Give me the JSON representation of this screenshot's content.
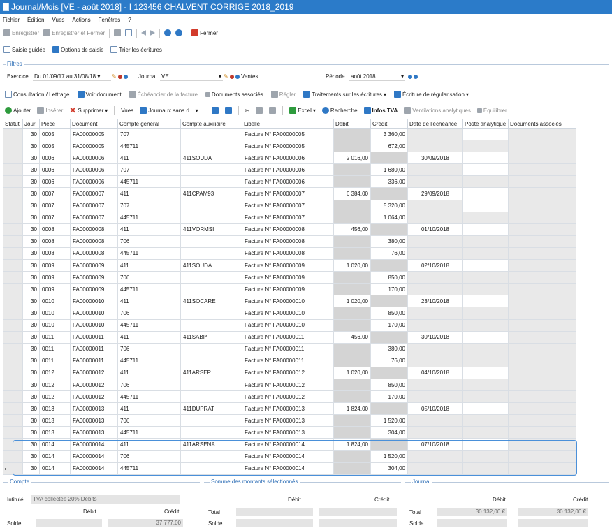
{
  "window": {
    "title": "Journal/Mois [VE - août 2018] - I 123456 CHALVENT CORRIGE 2018_2019"
  },
  "menu": [
    "Fichier",
    "Édition",
    "Vues",
    "Actions",
    "Fenêtres",
    "?"
  ],
  "toolbar1": {
    "save": "Enregistrer",
    "save_close": "Enregistrer et Fermer",
    "close": "Fermer"
  },
  "toolbar2": {
    "guided": "Saisie guidée",
    "options": "Options de saisie",
    "sort": "Trier les écritures"
  },
  "filters": {
    "legend": "Filtres",
    "exercice_label": "Exercice",
    "exercice_value": "Du 01/09/17 au 31/08/18",
    "journal_label": "Journal",
    "journal_value": "VE",
    "journal_name": "Ventes",
    "periode_label": "Période",
    "periode_value": "août 2018"
  },
  "toolbar3": {
    "consultation": "Consultation / Lettrage",
    "voir_doc": "Voir document",
    "echeancier": "Échéancier de la facture",
    "docs_assoc": "Documents associés",
    "regler": "Régler",
    "traitements": "Traitements sur les écritures",
    "regularisation": "Écriture de régularisation"
  },
  "toolbar4": {
    "ajouter": "Ajouter",
    "inserer": "Insérer",
    "supprimer": "Supprimer",
    "vues": "Vues",
    "journaux": "Journaux sans d...",
    "excel": "Excel",
    "recherche": "Recherche",
    "infos_tva": "Infos TVA",
    "ventilations": "Ventilations analytiques",
    "equilibrer": "Équilibrer"
  },
  "grid": {
    "columns": [
      "Statut",
      "Jour",
      "Pièce",
      "Document",
      "Compte général",
      "Compte auxiliaire",
      "Libellé",
      "Débit",
      "Crédit",
      "Date de l'échéance",
      "Poste analytique",
      "Documents associés"
    ],
    "rows": [
      {
        "jour": "30",
        "piece": "0005",
        "doc": "FA00000005",
        "cg": "707",
        "ca": "",
        "lib": "Facture N° FA00000005",
        "debit": "",
        "credit": "3 360,00",
        "ech": ""
      },
      {
        "jour": "30",
        "piece": "0005",
        "doc": "FA00000005",
        "cg": "445711",
        "ca": "",
        "lib": "Facture N° FA00000005",
        "debit": "",
        "credit": "672,00",
        "ech": ""
      },
      {
        "jour": "30",
        "piece": "0006",
        "doc": "FA00000006",
        "cg": "411",
        "ca": "411SOUDA",
        "lib": "Facture N° FA00000006",
        "debit": "2 016,00",
        "credit": "",
        "ech": "30/09/2018"
      },
      {
        "jour": "30",
        "piece": "0006",
        "doc": "FA00000006",
        "cg": "707",
        "ca": "",
        "lib": "Facture N° FA00000006",
        "debit": "",
        "credit": "1 680,00",
        "ech": ""
      },
      {
        "jour": "30",
        "piece": "0006",
        "doc": "FA00000006",
        "cg": "445711",
        "ca": "",
        "lib": "Facture N° FA00000006",
        "debit": "",
        "credit": "336,00",
        "ech": ""
      },
      {
        "jour": "30",
        "piece": "0007",
        "doc": "FA00000007",
        "cg": "411",
        "ca": "411CPAM93",
        "lib": "Facture N° FA00000007",
        "debit": "6 384,00",
        "credit": "",
        "ech": "29/09/2018"
      },
      {
        "jour": "30",
        "piece": "0007",
        "doc": "FA00000007",
        "cg": "707",
        "ca": "",
        "lib": "Facture N° FA00000007",
        "debit": "",
        "credit": "5 320,00",
        "ech": ""
      },
      {
        "jour": "30",
        "piece": "0007",
        "doc": "FA00000007",
        "cg": "445711",
        "ca": "",
        "lib": "Facture N° FA00000007",
        "debit": "",
        "credit": "1 064,00",
        "ech": ""
      },
      {
        "jour": "30",
        "piece": "0008",
        "doc": "FA00000008",
        "cg": "411",
        "ca": "411VORMSI",
        "lib": "Facture N° FA00000008",
        "debit": "456,00",
        "credit": "",
        "ech": "01/10/2018"
      },
      {
        "jour": "30",
        "piece": "0008",
        "doc": "FA00000008",
        "cg": "706",
        "ca": "",
        "lib": "Facture N° FA00000008",
        "debit": "",
        "credit": "380,00",
        "ech": ""
      },
      {
        "jour": "30",
        "piece": "0008",
        "doc": "FA00000008",
        "cg": "445711",
        "ca": "",
        "lib": "Facture N° FA00000008",
        "debit": "",
        "credit": "76,00",
        "ech": ""
      },
      {
        "jour": "30",
        "piece": "0009",
        "doc": "FA00000009",
        "cg": "411",
        "ca": "411SOUDA",
        "lib": "Facture N° FA00000009",
        "debit": "1 020,00",
        "credit": "",
        "ech": "02/10/2018"
      },
      {
        "jour": "30",
        "piece": "0009",
        "doc": "FA00000009",
        "cg": "706",
        "ca": "",
        "lib": "Facture N° FA00000009",
        "debit": "",
        "credit": "850,00",
        "ech": ""
      },
      {
        "jour": "30",
        "piece": "0009",
        "doc": "FA00000009",
        "cg": "445711",
        "ca": "",
        "lib": "Facture N° FA00000009",
        "debit": "",
        "credit": "170,00",
        "ech": ""
      },
      {
        "jour": "30",
        "piece": "0010",
        "doc": "FA00000010",
        "cg": "411",
        "ca": "411SOCARE",
        "lib": "Facture N° FA00000010",
        "debit": "1 020,00",
        "credit": "",
        "ech": "23/10/2018"
      },
      {
        "jour": "30",
        "piece": "0010",
        "doc": "FA00000010",
        "cg": "706",
        "ca": "",
        "lib": "Facture N° FA00000010",
        "debit": "",
        "credit": "850,00",
        "ech": ""
      },
      {
        "jour": "30",
        "piece": "0010",
        "doc": "FA00000010",
        "cg": "445711",
        "ca": "",
        "lib": "Facture N° FA00000010",
        "debit": "",
        "credit": "170,00",
        "ech": ""
      },
      {
        "jour": "30",
        "piece": "0011",
        "doc": "FA00000011",
        "cg": "411",
        "ca": "411SABP",
        "lib": "Facture N° FA00000011",
        "debit": "456,00",
        "credit": "",
        "ech": "30/10/2018"
      },
      {
        "jour": "30",
        "piece": "0011",
        "doc": "FA00000011",
        "cg": "706",
        "ca": "",
        "lib": "Facture N° FA00000011",
        "debit": "",
        "credit": "380,00",
        "ech": ""
      },
      {
        "jour": "30",
        "piece": "0011",
        "doc": "FA00000011",
        "cg": "445711",
        "ca": "",
        "lib": "Facture N° FA00000011",
        "debit": "",
        "credit": "76,00",
        "ech": ""
      },
      {
        "jour": "30",
        "piece": "0012",
        "doc": "FA00000012",
        "cg": "411",
        "ca": "411ARSEP",
        "lib": "Facture N° FA00000012",
        "debit": "1 020,00",
        "credit": "",
        "ech": "04/10/2018"
      },
      {
        "jour": "30",
        "piece": "0012",
        "doc": "FA00000012",
        "cg": "706",
        "ca": "",
        "lib": "Facture N° FA00000012",
        "debit": "",
        "credit": "850,00",
        "ech": ""
      },
      {
        "jour": "30",
        "piece": "0012",
        "doc": "FA00000012",
        "cg": "445711",
        "ca": "",
        "lib": "Facture N° FA00000012",
        "debit": "",
        "credit": "170,00",
        "ech": ""
      },
      {
        "jour": "30",
        "piece": "0013",
        "doc": "FA00000013",
        "cg": "411",
        "ca": "411DUPRAT",
        "lib": "Facture N° FA00000013",
        "debit": "1 824,00",
        "credit": "",
        "ech": "05/10/2018"
      },
      {
        "jour": "30",
        "piece": "0013",
        "doc": "FA00000013",
        "cg": "706",
        "ca": "",
        "lib": "Facture N° FA00000013",
        "debit": "",
        "credit": "1 520,00",
        "ech": ""
      },
      {
        "jour": "30",
        "piece": "0013",
        "doc": "FA00000013",
        "cg": "445711",
        "ca": "",
        "lib": "Facture N° FA00000013",
        "debit": "",
        "credit": "304,00",
        "ech": ""
      },
      {
        "jour": "30",
        "piece": "0014",
        "doc": "FA00000014",
        "cg": "411",
        "ca": "411ARSENA",
        "lib": "Facture N° FA00000014",
        "debit": "1 824,00",
        "credit": "",
        "ech": "07/10/2018"
      },
      {
        "jour": "30",
        "piece": "0014",
        "doc": "FA00000014",
        "cg": "706",
        "ca": "",
        "lib": "Facture N° FA00000014",
        "debit": "",
        "credit": "1 520,00",
        "ech": ""
      },
      {
        "jour": "30",
        "piece": "0014",
        "doc": "FA00000014",
        "cg": "445711",
        "ca": "",
        "lib": "Facture N° FA00000014",
        "debit": "",
        "credit": "304,00",
        "ech": ""
      }
    ]
  },
  "compte_panel": {
    "legend": "Compte",
    "intitule_label": "Intitulé",
    "intitule_value": "TVA collectée 20% Débits",
    "debit_label": "Débit",
    "credit_label": "Crédit",
    "solde_label": "Solde",
    "solde_credit": "37 777,00"
  },
  "somme_panel": {
    "legend": "Somme des montants sélectionnés",
    "debit_label": "Débit",
    "credit_label": "Crédit",
    "total_label": "Total",
    "solde_label": "Solde"
  },
  "journal_panel": {
    "legend": "Journal",
    "debit_label": "Débit",
    "credit_label": "Crédit",
    "total_label": "Total",
    "total_debit": "30 132,00 €",
    "total_credit": "30 132,00 €",
    "solde_label": "Solde"
  }
}
